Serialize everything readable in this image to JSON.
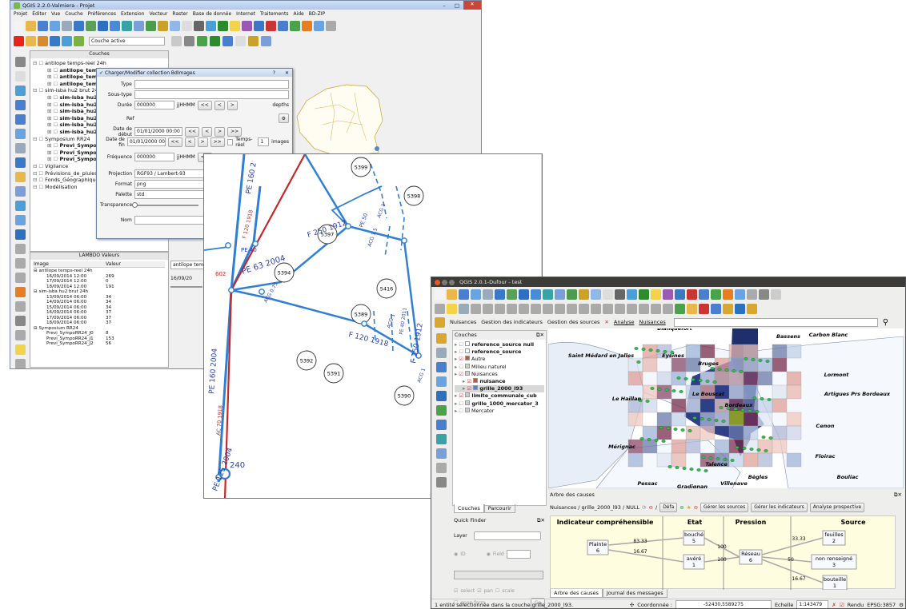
{
  "win1": {
    "title": "QGIS 2.2.0-Valmiera - Projet",
    "menus": [
      "Projet",
      "Éditer",
      "Vue",
      "Couche",
      "Préférences",
      "Extension",
      "Vecteur",
      "Raster",
      "Base de donnée",
      "Internet",
      "Traitements",
      "Aide",
      "BD-ZIP"
    ],
    "layer_combo": "Couche active",
    "layers_panel_title": "Couches",
    "layers": [
      {
        "text": "antilope temps-reel 24h",
        "level": 0,
        "bold": false
      },
      {
        "text": "antilope_temps-reel_010000_2014091612000",
        "level": 1,
        "bold": true
      },
      {
        "text": "antilope_temps-",
        "level": 1,
        "bold": true
      },
      {
        "text": "antilope_temps-",
        "level": 1,
        "bold": true
      },
      {
        "text": "sim-isba hu2 brut 24h",
        "level": 0,
        "bold": false
      },
      {
        "text": "sim-isba_hu2-br",
        "level": 1,
        "bold": true
      },
      {
        "text": "sim-isba_hu2-br",
        "level": 1,
        "bold": true
      },
      {
        "text": "sim-isba_hu2-br",
        "level": 1,
        "bold": true
      },
      {
        "text": "sim-isba_hu2-br",
        "level": 1,
        "bold": true
      },
      {
        "text": "sim-isba_hu2-br",
        "level": 1,
        "bold": true
      },
      {
        "text": "sim-isba_hu2-br",
        "level": 1,
        "bold": true
      },
      {
        "text": "Symposium RR24",
        "level": 0,
        "bold": false
      },
      {
        "text": "Previ_SympoRR2",
        "level": 1,
        "bold": true
      },
      {
        "text": "Previ_SympoRR2",
        "level": 1,
        "bold": true
      },
      {
        "text": "Previ_SympoRR2",
        "level": 1,
        "bold": true
      },
      {
        "text": "Vigilance",
        "level": 0,
        "bold": false
      },
      {
        "text": "Prévisions_de_pluies",
        "level": 0,
        "bold": false
      },
      {
        "text": "Fonds_Géographiques",
        "level": 0,
        "bold": false
      },
      {
        "text": "Modélisation",
        "level": 0,
        "bold": false
      }
    ],
    "dialog": {
      "title": "Charger/Modifier collection BdImages",
      "type_label": "Type",
      "soustype_label": "Sous-type",
      "duree_label": "Durée",
      "duree_value": "000000",
      "time_fmt": "jjHHMM",
      "depth_label": "depths",
      "ref_label": "Ref",
      "start_label": "Date de début",
      "start_value": "01/01/2000 00:00",
      "end_label": "Date de fin",
      "end_value": "01/01/2000 00:00",
      "tempsreel_label": "Temps-réel",
      "images_count": "1",
      "images_label": "images",
      "freq_label": "Fréquence",
      "freq_value": "000000",
      "proj_label": "Projection",
      "proj_value": "RGF93 / Lambert-93",
      "format_label": "Format",
      "format_value": "png",
      "palette_label": "Palette",
      "palette_value": "std",
      "transp_label": "Transparence",
      "nom_label": "Nom",
      "nav_first": "<<",
      "nav_prev": "<",
      "nav_next": ">",
      "nav_last": ">>"
    },
    "values_panel": {
      "title": "LAMBDO Valeurs",
      "col_image": "Image",
      "col_valeur": "Valeur",
      "rows": [
        {
          "img": "antilope temps-reel 24h",
          "val": "",
          "level": 0
        },
        {
          "img": "16/09/2014 12:00",
          "val": "269",
          "level": 1
        },
        {
          "img": "17/09/2014 12:00",
          "val": "0",
          "level": 1
        },
        {
          "img": "18/09/2014 12:00",
          "val": "191",
          "level": 1
        },
        {
          "img": "sim-isba hu2 brut 24h",
          "val": "",
          "level": 0
        },
        {
          "img": "13/09/2014 06:00",
          "val": "34",
          "level": 1
        },
        {
          "img": "14/09/2014 06:00",
          "val": "34",
          "level": 1
        },
        {
          "img": "15/09/2014 06:00",
          "val": "34",
          "level": 1
        },
        {
          "img": "16/09/2014 06:00",
          "val": "37",
          "level": 1
        },
        {
          "img": "17/09/2014 06:00",
          "val": "37",
          "level": 1
        },
        {
          "img": "18/09/2014 06:00",
          "val": "37",
          "level": 1
        },
        {
          "img": "Symposium RR24",
          "val": "",
          "level": 0
        },
        {
          "img": "Previ_SympoRR24_J0",
          "val": "8",
          "level": 1
        },
        {
          "img": "Previ_SympoRR24_J1",
          "val": "153",
          "level": 1
        },
        {
          "img": "Previ_SympoRR24_J2",
          "val": "56",
          "level": 1
        }
      ]
    },
    "chart_combo": "antilope temps-r",
    "chart_date": "16/09/20"
  },
  "network": {
    "nodes": [
      "5399",
      "5398",
      "5386",
      "5397",
      "5394",
      "5416",
      "5389",
      "5392",
      "5391",
      "5390"
    ],
    "labels": [
      "PE 160 2",
      "F 120 1918",
      "PE 40",
      "PE 63 2004",
      "602",
      "ACG 0.75",
      "F 250 1912",
      "PE 50",
      "ACG 1.5",
      "ACG 1",
      "F 120 1918",
      "PE 40 2011",
      "ACG 1",
      "F 250 1912",
      "PE 160 2004",
      "AC 70 1918",
      "240",
      "PE 125 2004",
      "ACG 1"
    ]
  },
  "win3": {
    "title": "QGIS 2.0.1-Dufour - test",
    "menu": {
      "nuisances": "Nuisances",
      "indicateurs": "Gestion des indicateurs",
      "sources": "Gestion des sources",
      "analyse": "Analyse",
      "nuisances2": "Nuisances"
    },
    "layers_title": "Couches",
    "layers": [
      {
        "text": "reference_source null",
        "level": 0,
        "bold": true,
        "checked": false,
        "color": "#fff"
      },
      {
        "text": "reference_source",
        "level": 0,
        "bold": true,
        "checked": false,
        "color": "#fff"
      },
      {
        "text": "Autre",
        "level": 0,
        "bold": false,
        "checked": true,
        "color": "#c0563d"
      },
      {
        "text": "Milieu naturel",
        "level": 0,
        "bold": false,
        "checked": false,
        "color": "#ccc"
      },
      {
        "text": "Nuisances",
        "level": 0,
        "bold": false,
        "checked": true,
        "color": "#ccc"
      },
      {
        "text": "nuisance",
        "level": 1,
        "bold": true,
        "checked": true,
        "color": "#c0563d"
      },
      {
        "text": "grille_2000_l93",
        "level": 1,
        "bold": true,
        "checked": true,
        "color": "#5a7fcf"
      },
      {
        "text": "limite_communale_cub",
        "level": 0,
        "bold": true,
        "checked": true,
        "color": "#ccc"
      },
      {
        "text": "grille_1000_mercator_3",
        "level": 0,
        "bold": true,
        "checked": false,
        "color": "#ccc"
      },
      {
        "text": "Mercator",
        "level": 0,
        "bold": false,
        "checked": false,
        "color": "#ccc"
      }
    ],
    "tabs": {
      "couches": "Couches",
      "parcourir": "Parcourir"
    },
    "quickfinder": {
      "title": "Quick Finder",
      "layer_label": "Layer",
      "id_label": "ID",
      "field_label": "Field",
      "select": "select",
      "pan": "pan",
      "scale": "scale",
      "open_form": "open form",
      "go": "Go"
    },
    "map_labels": {
      "bruges": "Bruges",
      "bassens": "Bassens",
      "carbon": "Carbon Blanc",
      "saint": "Saint Médard en Jalles",
      "eysines": "Eysines",
      "lormont": "Lormont",
      "lehaillan": "Le Haillan",
      "bouscat": "Le Bouscat",
      "bordeaux": "Bordeaux",
      "artigues": "Artigues Prs Bordeaux",
      "cenon": "Cenon",
      "floirac": "Floirac",
      "merignac": "Mérignac",
      "bouliac": "Bouliac",
      "pessac": "Pessac",
      "talence": "Talence",
      "begles": "Bègles",
      "villenave": "Villenave",
      "gradignan": "Gradignan",
      "blanquefort": "Blanquefort"
    },
    "arbre": {
      "title": "Arbre des causes",
      "breadcrumb": "Nuisances / grille_2000_l93 / NULL",
      "defaut": "Défa",
      "btn_sources": "Gérer les sources",
      "btn_indicateurs": "Gérer les indicateurs",
      "btn_analyse": "Analyse prospective",
      "headers": [
        "Indicateur compréhensible",
        "Etat",
        "Pression",
        "Source"
      ],
      "boxes": [
        {
          "name": "Plainte",
          "val": "6"
        },
        {
          "name": "bouché",
          "val": "5"
        },
        {
          "name": "avéré",
          "val": "1"
        },
        {
          "name": "Réseau",
          "val": "6"
        },
        {
          "name": "feuilles",
          "val": "2"
        },
        {
          "name": "non renseigné",
          "val": "3"
        },
        {
          "name": "bouteille",
          "val": "1"
        }
      ],
      "weights": [
        "83.33",
        "16.67",
        "100",
        "100",
        "33.33",
        "50",
        "16.67"
      ]
    },
    "bottom_tabs": {
      "arbre": "Arbre des causes",
      "journal": "Journal des messages"
    },
    "status": {
      "message": "1 entité sélectionnée dans la couche grille_2000_l93.",
      "coord_label": "Coordonnée :",
      "coord_value": "-52430,5589275",
      "scale_label": "Echelle",
      "scale_value": "1:143479",
      "render_label": "Rendu",
      "epsg": "EPSG:3857"
    }
  },
  "colors": {
    "node_blue": "#2f7fd6",
    "red_line": "#c62828",
    "label_blue": "#2a3fb0"
  }
}
